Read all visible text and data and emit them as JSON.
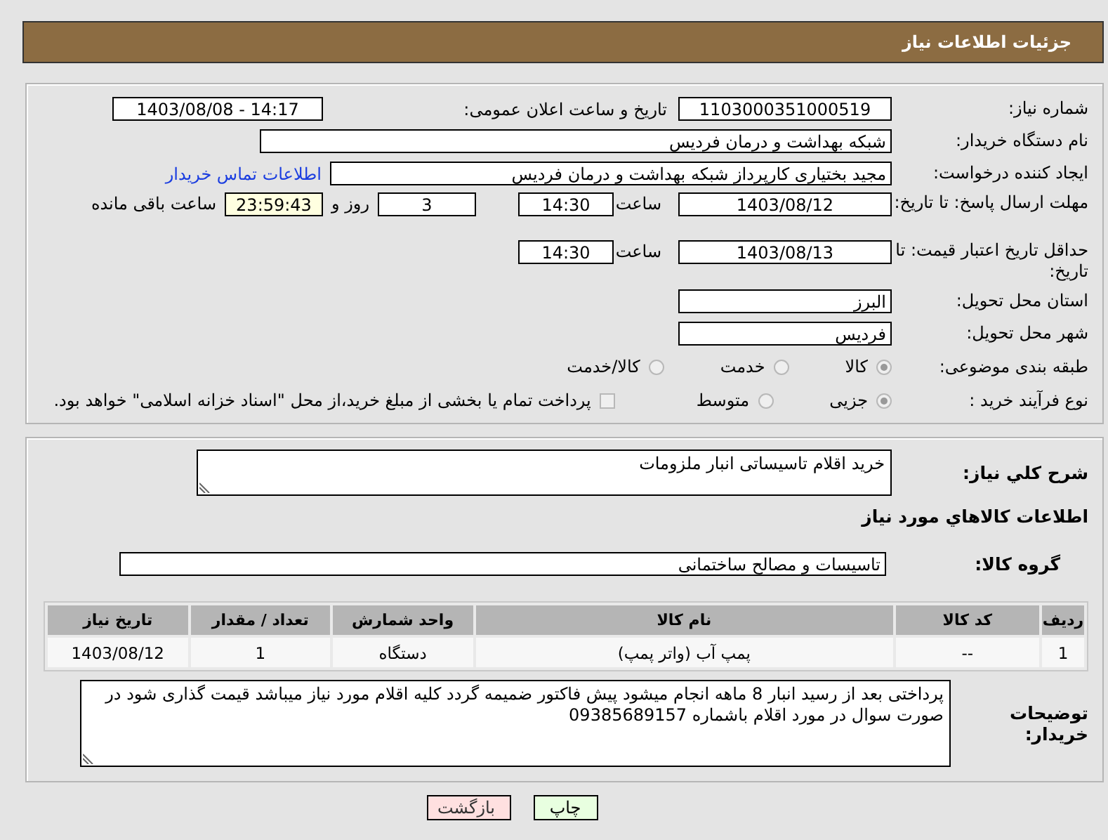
{
  "header": {
    "title": "جزئیات اطلاعات نیاز"
  },
  "need_number": {
    "label": "شماره نیاز:",
    "value": "1103000351000519"
  },
  "announce": {
    "label": "تاریخ و ساعت اعلان عمومی:",
    "value": "1403/08/08 - 14:17"
  },
  "buyer_org": {
    "label": "نام دستگاه خریدار:",
    "value": "شبکه بهداشت و درمان فردیس"
  },
  "requester": {
    "label": "ایجاد کننده درخواست:",
    "value": "مجید بختیاری کارپرداز شبکه بهداشت و درمان فردیس",
    "link": "اطلاعات تماس خریدار"
  },
  "response_deadline": {
    "label": "مهلت ارسال پاسخ: تا تاریخ:",
    "date": "1403/08/12",
    "time_label": "ساعت",
    "time": "14:30",
    "days": "3",
    "days_label": "روز و",
    "remaining": "23:59:43",
    "remaining_label": "ساعت باقی مانده"
  },
  "price_validity": {
    "label": "حداقل تاریخ اعتبار قیمت: تا تاریخ:",
    "date": "1403/08/13",
    "time_label": "ساعت",
    "time": "14:30"
  },
  "province": {
    "label": "استان محل تحویل:",
    "value": "البرز"
  },
  "city": {
    "label": "شهر محل تحویل:",
    "value": "فردیس"
  },
  "category": {
    "label": "طبقه بندی موضوعی:",
    "options": [
      {
        "label": "کالا",
        "selected": true
      },
      {
        "label": "خدمت",
        "selected": false
      },
      {
        "label": "کالا/خدمت",
        "selected": false
      }
    ]
  },
  "process": {
    "label": "نوع فرآیند خرید :",
    "options": [
      {
        "label": "جزیی",
        "selected": true
      },
      {
        "label": "متوسط",
        "selected": false
      }
    ],
    "checkbox": {
      "label": "پرداخت تمام یا بخشی از مبلغ خرید،از محل \"اسناد خزانه اسلامی\" خواهد بود.",
      "checked": false
    }
  },
  "description": {
    "label": "شرح كلي نياز:",
    "value": "خرید اقلام تاسیساتی انبار ملزومات"
  },
  "items_title": "اطلاعات كالاهاي مورد نياز",
  "goods_group": {
    "label": "گروه کالا:",
    "value": "تاسیسات و مصالح ساختمانی"
  },
  "table": {
    "columns": [
      "ردیف",
      "کد کالا",
      "نام کالا",
      "واحد شمارش",
      "تعداد / مقدار",
      "تاریخ نیاز"
    ],
    "rows": [
      [
        "1",
        "--",
        "پمپ آب (واتر پمپ)",
        "دستگاه",
        "1",
        "1403/08/12"
      ]
    ]
  },
  "buyer_notes": {
    "label": "توضیحات خریدار:",
    "value": "پرداختی بعد از رسید انبار 8 ماهه انجام میشود پیش فاکتور ضمیمه گردد کلیه اقلام مورد نیاز میباشد قیمت گذاری شود در صورت سوال در مورد اقلام باشماره 09385689157"
  },
  "buttons": [
    {
      "label": "چاپ",
      "kind": "print"
    },
    {
      "label": "بازگشت",
      "kind": "back"
    }
  ]
}
